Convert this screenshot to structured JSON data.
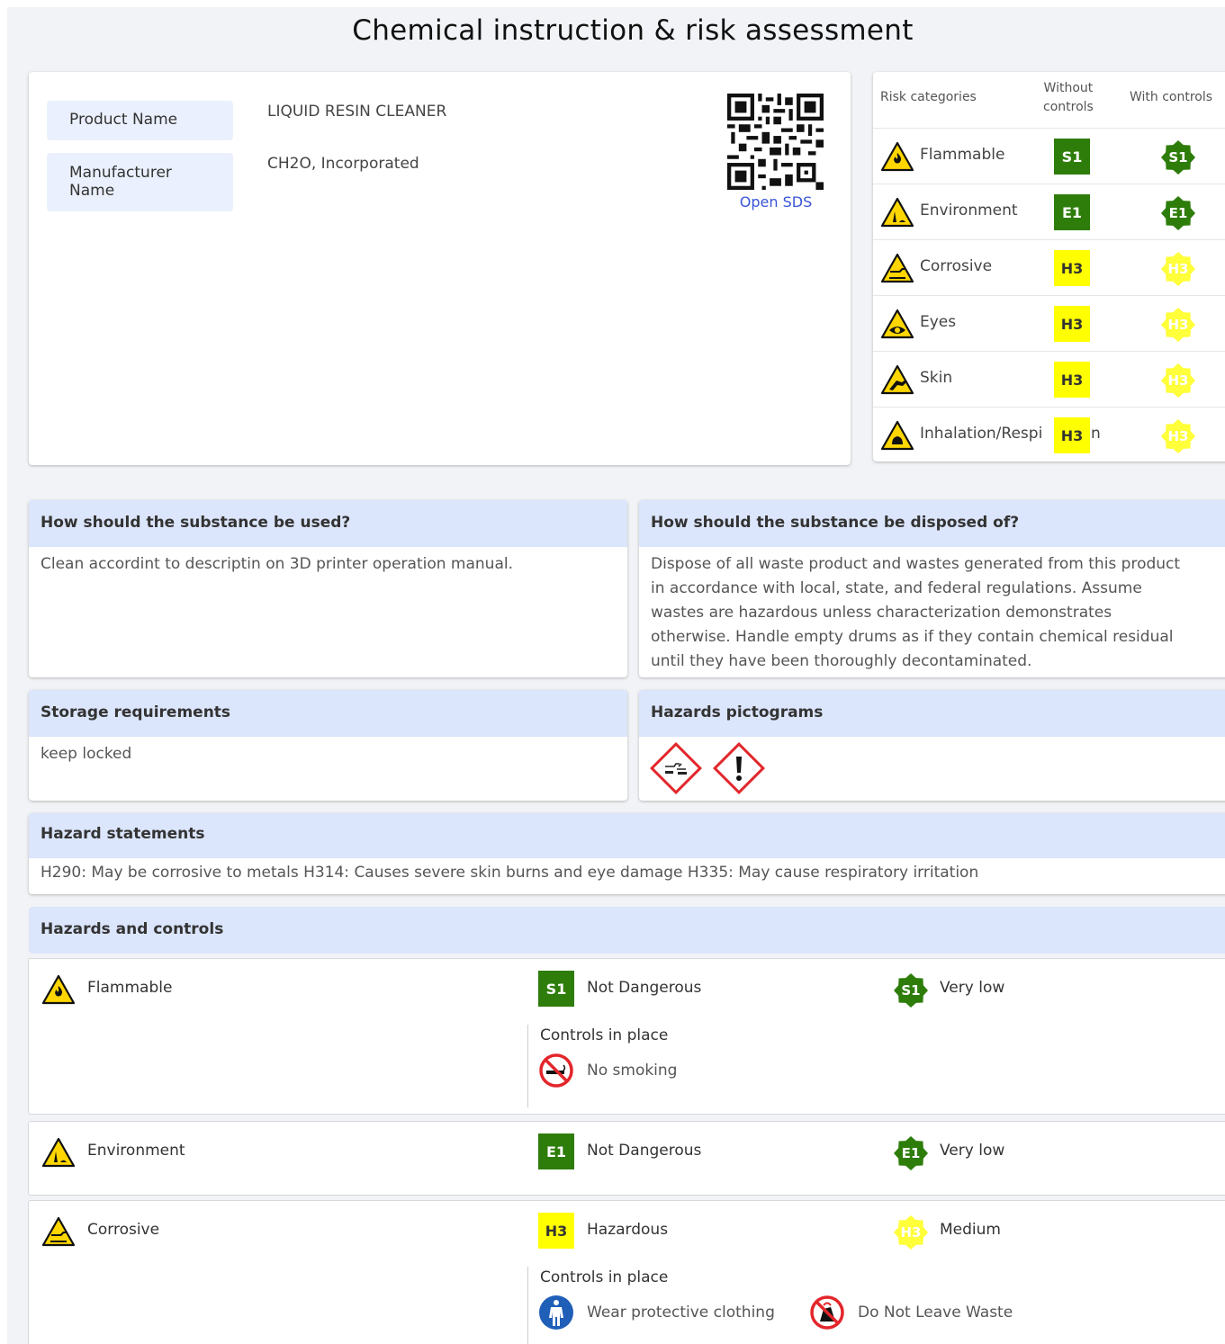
{
  "title": "Chemical instruction & risk assessment",
  "product": {
    "product_name_label": "Product Name",
    "product_name": "LIQUID RESIN CLEANER",
    "manufacturer_label_line1": "Manufacturer",
    "manufacturer_label_line2": "Name",
    "manufacturer": "CH2O, Incorporated",
    "open_sds": "Open SDS"
  },
  "risk_table": {
    "col_categories": "Risk categories",
    "col_without_line1": "Without",
    "col_without_line2": "controls",
    "col_with": "With controls",
    "rows": [
      {
        "name": "Flammable",
        "without": "S1",
        "with": "S1",
        "color": "#2e7d0b",
        "icon": "flammable-icon"
      },
      {
        "name": "Environment",
        "without": "E1",
        "with": "E1",
        "color": "#2e7d0b",
        "icon": "environment-icon"
      },
      {
        "name": "Corrosive",
        "without": "H3",
        "with": "H3",
        "color": "#ffff00",
        "icon": "corrosive-icon"
      },
      {
        "name": "Eyes",
        "without": "H3",
        "with": "H3",
        "color": "#ffff00",
        "icon": "eye-icon"
      },
      {
        "name": "Skin",
        "without": "H3",
        "with": "H3",
        "color": "#ffff00",
        "icon": "skin-icon"
      },
      {
        "name": "Inhalation/Respi",
        "name_tail": "n",
        "without": "H3",
        "with": "H3",
        "color": "#ffff00",
        "icon": "inhalation-icon"
      }
    ]
  },
  "usage": {
    "heading": "How should the substance be used?",
    "text": "Clean accordint to descriptin on 3D printer operation manual."
  },
  "disposal": {
    "heading": "How should the substance be disposed of?",
    "lines": [
      "Dispose of all waste product and wastes generated from this product",
      "in accordance with local, state, and federal regulations. Assume",
      "wastes are hazardous unless characterization demonstrates",
      "otherwise. Handle empty drums as if they contain chemical residual",
      "until they have been thoroughly decontaminated."
    ]
  },
  "storage": {
    "heading": "Storage requirements",
    "text": "keep locked"
  },
  "pictograms": {
    "heading": "Hazards pictograms",
    "items": [
      "corrosion-pictogram-icon",
      "exclamation-pictogram-icon"
    ]
  },
  "hazard_statements": {
    "heading": "Hazard statements",
    "text": "H290: May be corrosive to metals H314: Causes severe skin burns and eye damage H335: May cause respiratory irritation"
  },
  "hazards_controls": {
    "heading": "Hazards and controls",
    "controls_title": "Controls in place",
    "items": [
      {
        "name": "Flammable",
        "code": "S1",
        "status": "Not Dangerous",
        "with_code": "S1",
        "level": "Very low",
        "color": "#2e7d0b",
        "controls": [
          {
            "label": "No smoking",
            "icon": "no-smoking-icon"
          }
        ]
      },
      {
        "name": "Environment",
        "code": "E1",
        "status": "Not Dangerous",
        "with_code": "E1",
        "level": "Very low",
        "color": "#2e7d0b",
        "controls": []
      },
      {
        "name": "Corrosive",
        "code": "H3",
        "status": "Hazardous",
        "with_code": "H3",
        "level": "Medium",
        "color": "#ffff00",
        "controls": [
          {
            "label": "Wear protective clothing",
            "icon": "protective-clothing-icon"
          },
          {
            "label": "Do Not Leave Waste",
            "icon": "no-waste-icon"
          }
        ]
      }
    ]
  }
}
